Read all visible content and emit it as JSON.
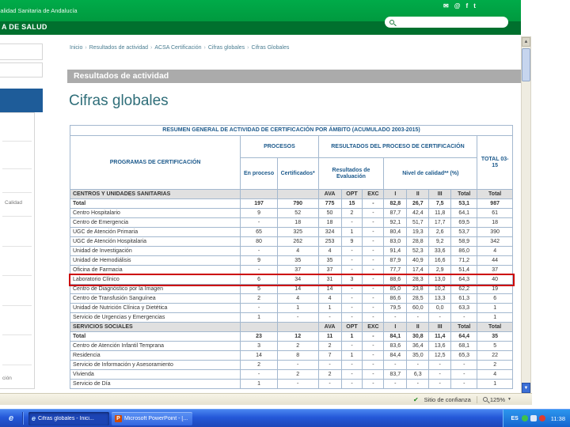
{
  "header": {
    "logo_line1": "Calidad Sanitaria de Andalucía",
    "logo_line2": "A DE SALUD",
    "social": [
      {
        "name": "email-icon",
        "glyph": "✉"
      },
      {
        "name": "contact-icon",
        "glyph": "@"
      },
      {
        "name": "facebook-icon",
        "glyph": "f"
      },
      {
        "name": "twitter-icon",
        "glyph": "t"
      }
    ],
    "search": {
      "placeholder": "",
      "value": ""
    }
  },
  "breadcrumb": {
    "separator": "›",
    "items": [
      "Inicio",
      "Resultados de actividad",
      "ACSA Certificación",
      "Cifras globales",
      "Cifras Globales"
    ]
  },
  "section_band": "Resultados de actividad",
  "page_title": "Cifras globales",
  "sidebar": {
    "fragments": [
      "Calidad",
      "ción"
    ]
  },
  "table": {
    "title": "RESUMEN GENERAL DE ACTIVIDAD DE CERTIFICACIÓN POR ÁMBITO (ACUMULADO 2003-2015)",
    "col_groups": {
      "programs": "PROGRAMAS DE CERTIFICACIÓN",
      "processes": "PROCESOS",
      "results": "RESULTADOS DEL PROCESO DE CERTIFICACIÓN",
      "total": "TOTAL 03-15"
    },
    "sub_headers": {
      "in_process": "En proceso",
      "certified": "Certificados*",
      "evaluation": "Resultados de Evaluación",
      "quality": "Nivel de calidad** (%)"
    },
    "col_letters": [
      "AVA",
      "OPT",
      "EXC",
      "I",
      "II",
      "III",
      "Total",
      "Total"
    ],
    "sections": [
      {
        "name": "CENTROS Y UNIDADES SANITARIAS",
        "rows": [
          {
            "label": "Total",
            "bold": true,
            "values": [
              "197",
              "790",
              "775",
              "15",
              "-",
              "82,8",
              "26,7",
              "7,5",
              "53,1",
              "987"
            ]
          },
          {
            "label": "Centro Hospitalario",
            "values": [
              "9",
              "52",
              "50",
              "2",
              "-",
              "87,7",
              "42,4",
              "11,8",
              "64,1",
              "61"
            ]
          },
          {
            "label": "Centro de Emergencia",
            "values": [
              "-",
              "18",
              "18",
              "-",
              "-",
              "92,1",
              "51,7",
              "17,7",
              "69,5",
              "18"
            ]
          },
          {
            "label": "UGC de Atención Primaria",
            "values": [
              "65",
              "325",
              "324",
              "1",
              "-",
              "80,4",
              "19,3",
              "2,6",
              "53,7",
              "390"
            ]
          },
          {
            "label": "UGC de Atención Hospitalaria",
            "values": [
              "80",
              "262",
              "253",
              "9",
              "-",
              "83,0",
              "28,8",
              "9,2",
              "58,9",
              "342"
            ]
          },
          {
            "label": "Unidad de Investigación",
            "values": [
              "-",
              "4",
              "4",
              "-",
              "-",
              "91,4",
              "52,3",
              "33,6",
              "86,0",
              "4"
            ]
          },
          {
            "label": "Unidad de Hemodiálisis",
            "values": [
              "9",
              "35",
              "35",
              "-",
              "-",
              "87,9",
              "40,9",
              "16,6",
              "71,2",
              "44"
            ]
          },
          {
            "label": "Oficina de Farmacia",
            "values": [
              "-",
              "37",
              "37",
              "-",
              "-",
              "77,7",
              "17,4",
              "2,9",
              "51,4",
              "37"
            ]
          },
          {
            "label": "Laboratorio Clínico",
            "highlight": true,
            "values": [
              "6",
              "34",
              "31",
              "3",
              "-",
              "88,6",
              "28,3",
              "13,0",
              "64,3",
              "40"
            ]
          },
          {
            "label": "Centro de Diagnóstico por la Imagen",
            "values": [
              "5",
              "14",
              "14",
              "-",
              "-",
              "85,0",
              "23,8",
              "10,2",
              "62,2",
              "19"
            ]
          },
          {
            "label": "Centro de Transfusión Sanguínea",
            "values": [
              "2",
              "4",
              "4",
              "-",
              "-",
              "86,6",
              "28,5",
              "13,3",
              "61,3",
              "6"
            ]
          },
          {
            "label": "Unidad de Nutrición Clínica y Dietética",
            "values": [
              "-",
              "1",
              "1",
              "-",
              "-",
              "79,5",
              "60,0",
              "0,0",
              "63,3",
              "1"
            ]
          },
          {
            "label": "Servicio de Urgencias y Emergencias",
            "values": [
              "1",
              "-",
              "-",
              "-",
              "-",
              "-",
              "-",
              "-",
              "-",
              "1"
            ]
          }
        ]
      },
      {
        "name": "SERVICIOS SOCIALES",
        "rows": [
          {
            "label": "Total",
            "bold": true,
            "values": [
              "23",
              "12",
              "11",
              "1",
              "-",
              "84,1",
              "30,8",
              "11,4",
              "64,4",
              "35"
            ]
          },
          {
            "label": "Centro de Atención Infantil Temprana",
            "values": [
              "3",
              "2",
              "2",
              "-",
              "-",
              "83,6",
              "36,4",
              "13,6",
              "68,1",
              "5"
            ]
          },
          {
            "label": "Residencia",
            "values": [
              "14",
              "8",
              "7",
              "1",
              "-",
              "84,4",
              "35,0",
              "12,5",
              "65,3",
              "22"
            ]
          },
          {
            "label": "Servicio de Información y Asesoramiento",
            "values": [
              "2",
              "-",
              "-",
              "-",
              "-",
              "-",
              "-",
              "-",
              "-",
              "2"
            ]
          },
          {
            "label": "Vivienda",
            "values": [
              "-",
              "2",
              "2",
              "-",
              "-",
              "83,7",
              "6,3",
              "-",
              "-",
              "4"
            ]
          },
          {
            "label": "Servicio de Día",
            "values": [
              "1",
              "-",
              "-",
              "-",
              "-",
              "-",
              "-",
              "-",
              "-",
              "1"
            ]
          }
        ]
      }
    ]
  },
  "status_bar": {
    "trusted_label": "Sitio de confianza",
    "zoom_level": "125%"
  },
  "taskbar": {
    "tasks": [
      {
        "icon": "internet-explorer-icon",
        "label": "Cifras globales - Inici...",
        "active": true
      },
      {
        "icon": "powerpoint-icon",
        "label": "Microsoft PowerPoint - [...",
        "active": false
      }
    ],
    "tray": {
      "language": "ES",
      "icons": [
        "messenger-icon",
        "volume-icon",
        "security-icon"
      ],
      "time": "11:38"
    }
  },
  "colors": {
    "brand_green": "#009B3E",
    "dark_green": "#00702E",
    "table_border": "#A3B8CF",
    "header_text": "#1D5A8C",
    "highlight_red": "#CC0000",
    "taskbar_blue": "#2458D8"
  }
}
